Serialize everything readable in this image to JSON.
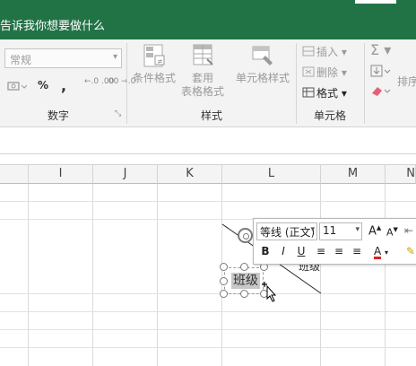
{
  "title_bar": {
    "tell_me": "告诉我你想要做什么"
  },
  "ribbon": {
    "number_group": {
      "format_value": "常规",
      "percent": "%",
      "comma": ",",
      "inc_decimal": "←.0 .00",
      "dec_decimal": ".00 →.0",
      "label": "数字"
    },
    "styles_group": {
      "conditional_format": "条件格式",
      "table_format_line1": "套用",
      "table_format_line2": "表格格式",
      "cell_styles": "单元格样式",
      "label": "样式"
    },
    "cells_group": {
      "insert": "插入",
      "delete": "删除",
      "format": "格式",
      "label": "单元格"
    },
    "editing_group": {
      "sort": "排序"
    }
  },
  "grid": {
    "columns": [
      "I",
      "J",
      "K",
      "L",
      "M",
      "N"
    ]
  },
  "textbox": {
    "text": "班级",
    "right_text": "班级"
  },
  "mini_toolbar": {
    "font_name": "等线 (正文)",
    "font_size": "11",
    "grow": "A",
    "shrink": "A",
    "bold": "B",
    "italic": "I",
    "underline": "U",
    "font_color": "A"
  },
  "colors": {
    "title_bar": "#217346",
    "ribbon_bg": "#f3f3f3",
    "selection": "#c8c8c8",
    "font_color_bar": "#e02020"
  }
}
